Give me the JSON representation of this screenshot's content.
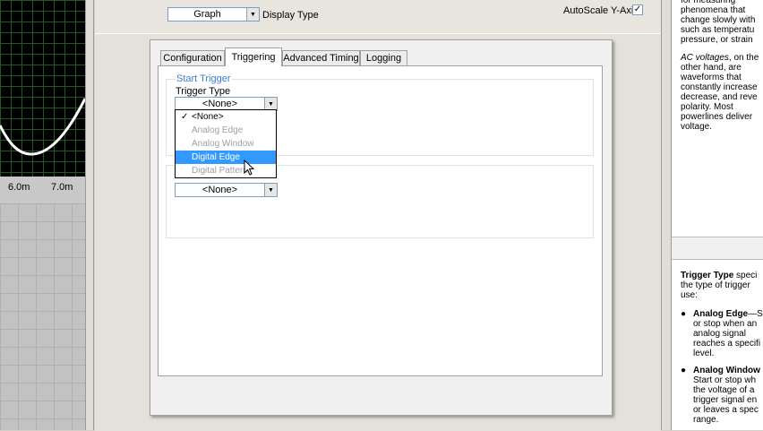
{
  "graph": {
    "tick_labels": [
      "6.0m",
      "7.0m"
    ],
    "trace_color": "#ffffff",
    "grid_color": "#1f5a1f"
  },
  "top": {
    "display_type_value": "Graph",
    "display_type_label": "Display Type",
    "autoscale_label": "AutoScale Y-Axis",
    "autoscale_checked": "✓"
  },
  "tabs": [
    {
      "label": "Configuration"
    },
    {
      "label": "Triggering"
    },
    {
      "label": "Advanced Timing"
    },
    {
      "label": "Logging"
    }
  ],
  "triggering": {
    "start_trigger_title": "Start Trigger",
    "trigger_type_label": "Trigger Type",
    "trigger_type_value": "<None>",
    "stop_trigger_value": "<None>",
    "dropdown_items": [
      {
        "label": "<None>",
        "checked": "✓"
      },
      {
        "label": "Analog Edge"
      },
      {
        "label": "Analog Window"
      },
      {
        "label": "Digital Edge"
      },
      {
        "label": "Digital Pattern"
      }
    ]
  },
  "help": {
    "p1": "for measuring phenomena that change slowly with such as temperatu pressure, or strain",
    "p2_em": "AC voltages",
    "p2": ", on the other hand, are waveforms that constantly increase decrease, and reve polarity. Most powerlines deliver voltage.",
    "p3_bold": "Trigger Type",
    "p3": " speci the type of trigger use:",
    "b1_bold": "Analog Edge",
    "b1": "—S or stop when an analog signal reaches a specifi level.",
    "b2_bold": "Analog Window",
    "b2": "Start or stop wh the voltage of a trigger signal en or leaves a spec range."
  },
  "colors": {
    "selection": "#3399ff",
    "group_title": "#3a7fd5"
  }
}
